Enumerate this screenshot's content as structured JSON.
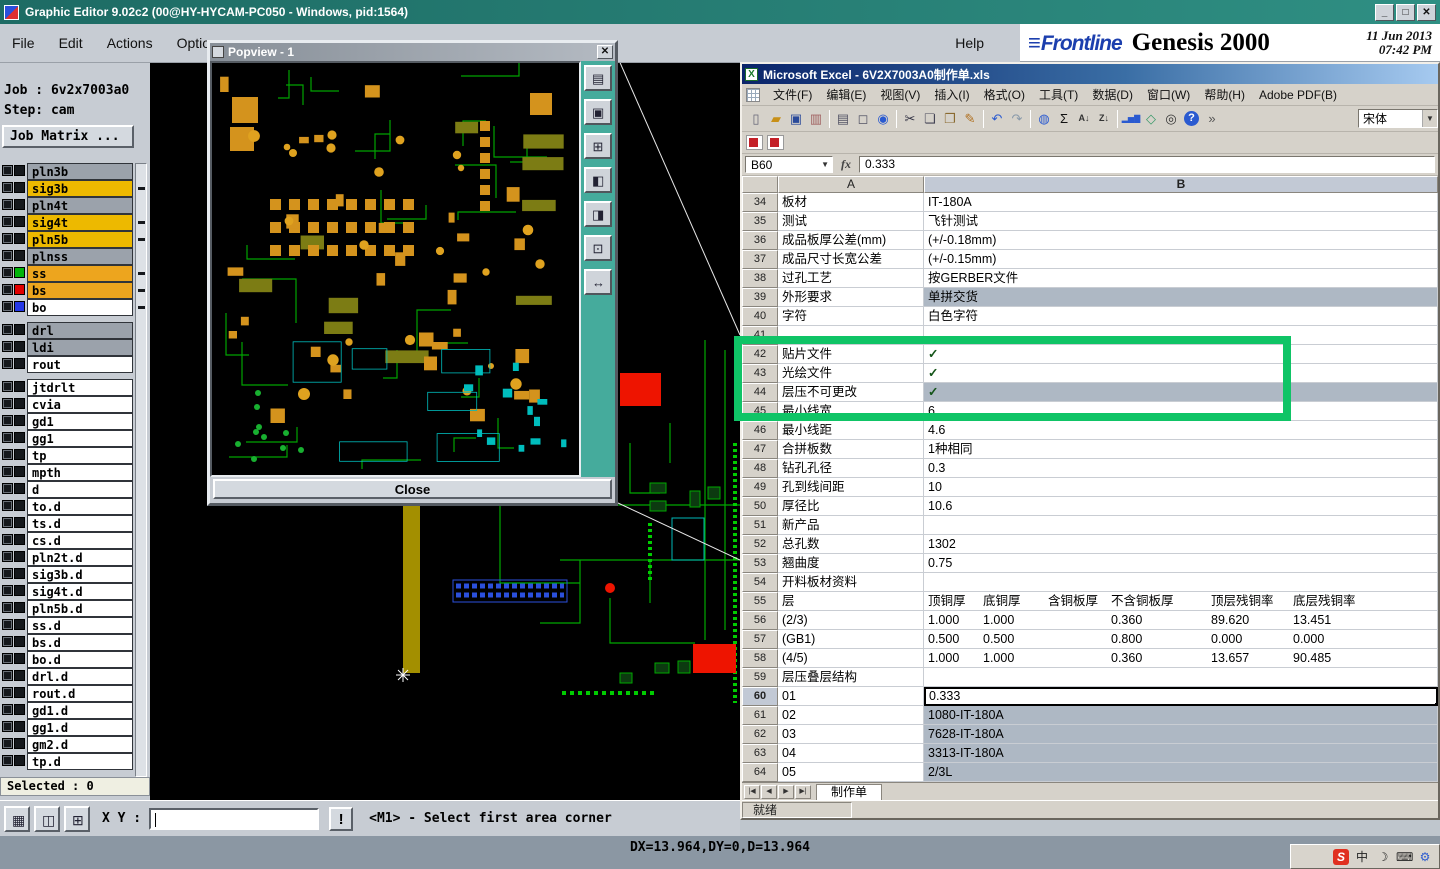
{
  "app": {
    "title": "Graphic Editor 9.02c2 (00@HY-HYCAM-PC050 - Windows, pid:1564)",
    "menus": [
      "File",
      "Edit",
      "Actions",
      "Options"
    ],
    "help": "Help",
    "window_buttons": [
      "_",
      "□",
      "✕"
    ],
    "brand": {
      "logo": "Frontline",
      "product": "Genesis 2000",
      "date": "11 Jun 2013",
      "time": "07:42 PM"
    }
  },
  "sidebar": {
    "job": "Job : 6v2x7003a0",
    "step": "Step: cam",
    "job_matrix": "Job Matrix ...",
    "selected": "Selected : 0",
    "layers": [
      {
        "name": "pln3b",
        "bg": "#9ba2ab"
      },
      {
        "name": "sig3b",
        "bg": "#edb900",
        "tick": true
      },
      {
        "name": "pln4t",
        "bg": "#9ba2ab"
      },
      {
        "name": "sig4t",
        "bg": "#edb900",
        "tick": true
      },
      {
        "name": "pln5b",
        "bg": "#edb900",
        "tick": true
      },
      {
        "name": "plnss",
        "bg": "#9ba2ab"
      },
      {
        "name": "ss",
        "bg": "#eda51e",
        "swatch": "#00b40a",
        "tick": true
      },
      {
        "name": "bs",
        "bg": "#eda51e",
        "swatch": "#e00000",
        "tick": true
      },
      {
        "name": "bo",
        "bg": "#ffffff",
        "swatch": "#2437e6",
        "tick": true,
        "gap_after": true
      },
      {
        "name": "drl",
        "bg": "#9ba2ab"
      },
      {
        "name": "ldi",
        "bg": "#9ba2ab"
      },
      {
        "name": "rout",
        "bg": "#ffffff",
        "gap_after": true
      },
      {
        "name": "jtdrlt",
        "bg": "#ffffff"
      },
      {
        "name": "cvia",
        "bg": "#ffffff"
      },
      {
        "name": "gd1",
        "bg": "#ffffff"
      },
      {
        "name": "gg1",
        "bg": "#ffffff"
      },
      {
        "name": "tp",
        "bg": "#ffffff"
      },
      {
        "name": "mpth",
        "bg": "#ffffff"
      },
      {
        "name": "d",
        "bg": "#ffffff"
      },
      {
        "name": "to.d",
        "bg": "#ffffff"
      },
      {
        "name": "ts.d",
        "bg": "#ffffff"
      },
      {
        "name": "cs.d",
        "bg": "#ffffff"
      },
      {
        "name": "pln2t.d",
        "bg": "#ffffff"
      },
      {
        "name": "sig3b.d",
        "bg": "#ffffff"
      },
      {
        "name": "sig4t.d",
        "bg": "#ffffff"
      },
      {
        "name": "pln5b.d",
        "bg": "#ffffff"
      },
      {
        "name": "ss.d",
        "bg": "#ffffff"
      },
      {
        "name": "bs.d",
        "bg": "#ffffff"
      },
      {
        "name": "bo.d",
        "bg": "#ffffff"
      },
      {
        "name": "drl.d",
        "bg": "#ffffff"
      },
      {
        "name": "rout.d",
        "bg": "#ffffff"
      },
      {
        "name": "gd1.d",
        "bg": "#ffffff"
      },
      {
        "name": "gg1.d",
        "bg": "#ffffff"
      },
      {
        "name": "gm2.d",
        "bg": "#ffffff"
      },
      {
        "name": "tp.d",
        "bg": "#ffffff"
      }
    ]
  },
  "popview": {
    "title": "Popview - 1",
    "close_glyph": "✕",
    "close_button": "Close",
    "tools": [
      {
        "icon": "export-view-icon",
        "glyph": "▤"
      },
      {
        "icon": "snapshot-icon",
        "glyph": "▣"
      },
      {
        "icon": "zoom-window-icon",
        "glyph": "⊞"
      },
      {
        "icon": "pan-left-icon",
        "glyph": "◧"
      },
      {
        "icon": "pan-right-icon",
        "glyph": "◨"
      },
      {
        "icon": "zoom-area-icon",
        "glyph": "⊡"
      },
      {
        "icon": "pan-icon",
        "glyph": "↔"
      }
    ]
  },
  "excel": {
    "title": "Microsoft Excel - 6V2X7003A0制作单.xls",
    "menus": [
      "文件(F)",
      "编辑(E)",
      "视图(V)",
      "插入(I)",
      "格式(O)",
      "工具(T)",
      "数据(D)",
      "窗口(W)",
      "帮助(H)",
      "Adobe PDF(B)"
    ],
    "toolbar": [
      {
        "name": "new-icon",
        "glyph": "▯"
      },
      {
        "name": "open-icon",
        "glyph": "▰"
      },
      {
        "name": "save-icon",
        "glyph": "▣"
      },
      {
        "name": "permission-icon",
        "glyph": "▥"
      },
      {
        "sep": true
      },
      {
        "name": "print-icon",
        "glyph": "▤"
      },
      {
        "name": "print-preview-icon",
        "glyph": "◻"
      },
      {
        "name": "research-icon",
        "glyph": "◉"
      },
      {
        "sep": true
      },
      {
        "name": "cut-icon",
        "glyph": "✂"
      },
      {
        "name": "copy-icon",
        "glyph": "❏"
      },
      {
        "name": "paste-icon",
        "glyph": "❐"
      },
      {
        "name": "format-painter-icon",
        "glyph": "✎"
      },
      {
        "sep": true
      },
      {
        "name": "undo-icon",
        "glyph": "↶"
      },
      {
        "name": "redo-icon",
        "glyph": "↷"
      },
      {
        "sep": true
      },
      {
        "name": "hyperlink-icon",
        "glyph": "◍"
      },
      {
        "name": "autosum-icon",
        "glyph": "Σ"
      },
      {
        "name": "sort-asc-icon",
        "glyph": "A↓"
      },
      {
        "name": "sort-desc-icon",
        "glyph": "Z↓"
      },
      {
        "sep": true
      },
      {
        "name": "chart-icon",
        "glyph": "▂▅▇"
      },
      {
        "name": "drawing-icon",
        "glyph": "◇"
      },
      {
        "name": "zoom-icon",
        "glyph": "◎"
      },
      {
        "name": "help-icon",
        "glyph": "?"
      },
      {
        "name": "toolbar-options-icon",
        "glyph": "»"
      }
    ],
    "toolbar2_icons": [
      "adobe-pdf-icon",
      "adobe-pdf-email-icon"
    ],
    "font_name": "宋体",
    "name_box": "B60",
    "fx_label": "fx",
    "formula_value": "0.333",
    "columns": [
      "A",
      "B"
    ],
    "rows": [
      {
        "n": "34",
        "a": "板材",
        "b": "IT-180A"
      },
      {
        "n": "35",
        "a": "测试",
        "b": "飞针测试"
      },
      {
        "n": "36",
        "a": "成品板厚公差(mm)",
        "b": "(+/-0.18mm)"
      },
      {
        "n": "37",
        "a": "成品尺寸长宽公差",
        "b": "(+/-0.15mm)"
      },
      {
        "n": "38",
        "a": "过孔工艺",
        "b": "按GERBER文件"
      },
      {
        "n": "39",
        "a": "外形要求",
        "b": "单拼交货",
        "b_gray": true
      },
      {
        "n": "40",
        "a": "字符",
        "b": "白色字符"
      },
      {
        "n": "41",
        "a": "",
        "b": ""
      },
      {
        "n": "42",
        "a": "贴片文件",
        "b": "✓",
        "check": true
      },
      {
        "n": "43",
        "a": "光绘文件",
        "b": "✓",
        "check": true
      },
      {
        "n": "44",
        "a": "层压不可更改",
        "b": "✓",
        "check": true,
        "b_gray": true
      },
      {
        "n": "45",
        "a": "最小线宽",
        "b": "6"
      },
      {
        "n": "46",
        "a": "最小线距",
        "b": "4.6"
      },
      {
        "n": "47",
        "a": "合拼板数",
        "b": "1种相同"
      },
      {
        "n": "48",
        "a": "钻孔孔径",
        "b": "0.3"
      },
      {
        "n": "49",
        "a": "孔到线间距",
        "b": "10"
      },
      {
        "n": "50",
        "a": "厚径比",
        "b": "10.6"
      },
      {
        "n": "51",
        "a": "新产品",
        "b": ""
      },
      {
        "n": "52",
        "a": "总孔数",
        "b": "1302"
      },
      {
        "n": "53",
        "a": "翘曲度",
        "b": "0.75"
      },
      {
        "n": "54",
        "a": "开料板材资料",
        "b": ""
      },
      {
        "n": "55",
        "a": "层",
        "b": [
          "顶铜厚",
          "底铜厚",
          "含铜板厚",
          "不含铜板厚",
          "顶层残铜率",
          "底层残铜率"
        ]
      },
      {
        "n": "56",
        "a": "(2/3)",
        "b": [
          "1.000",
          "1.000",
          "",
          "0.360",
          "89.620",
          "13.451"
        ]
      },
      {
        "n": "57",
        "a": "(GB1)",
        "b": [
          "0.500",
          "0.500",
          "",
          "0.800",
          "0.000",
          "0.000"
        ]
      },
      {
        "n": "58",
        "a": "(4/5)",
        "b": [
          "1.000",
          "1.000",
          "",
          "0.360",
          "13.657",
          "90.485"
        ]
      },
      {
        "n": "59",
        "a": "层压叠层结构",
        "b": ""
      },
      {
        "n": "60",
        "a": "01",
        "b": "0.333",
        "selected": true
      },
      {
        "n": "61",
        "a": "02",
        "b": "1080-IT-180A",
        "b_gray": true
      },
      {
        "n": "62",
        "a": "03",
        "b": "7628-IT-180A",
        "b_gray": true
      },
      {
        "n": "63",
        "a": "04",
        "b": "3313-IT-180A",
        "b_gray": true
      },
      {
        "n": "64",
        "a": "05",
        "b": "2/3L",
        "b_gray": true
      }
    ],
    "tab_nav": [
      {
        "name": "first-sheet-icon",
        "glyph": "|◀"
      },
      {
        "name": "prev-sheet-icon",
        "glyph": "◀"
      },
      {
        "name": "next-sheet-icon",
        "glyph": "▶"
      },
      {
        "name": "last-sheet-icon",
        "glyph": "▶|"
      }
    ],
    "sheet_tab": "制作单",
    "status": "就绪"
  },
  "bottombar": {
    "buttons": [
      {
        "icon": "overlay-icon",
        "glyph": "▦"
      },
      {
        "icon": "split-view-icon",
        "glyph": "◫"
      },
      {
        "icon": "grid-icon",
        "glyph": "⊞"
      }
    ],
    "xy_label": "X Y :",
    "input_value": "",
    "alert_label": "!",
    "prompt": "<M1> - Select first area corner"
  },
  "status": {
    "coords": "DX=13.964,DY=0,D=13.964"
  },
  "tray": {
    "icons": [
      {
        "name": "sogou-icon",
        "glyph": "S"
      },
      {
        "name": "chinese-ime-icon",
        "glyph": "中"
      },
      {
        "name": "ime-moon-icon",
        "glyph": "☽"
      },
      {
        "name": "keyboard-icon",
        "glyph": "⌨"
      },
      {
        "name": "wrench-icon",
        "glyph": "⚙"
      }
    ]
  },
  "highlight_color": "#0fc466"
}
